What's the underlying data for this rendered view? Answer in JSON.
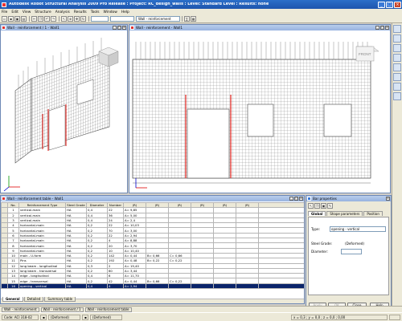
{
  "app": {
    "title": "Autodesk Robot Structural Analysis 2009 Pro Release : Project: RC_design_walls : Level: Standard Level : Results: none"
  },
  "menu": [
    "File",
    "Edit",
    "View",
    "Structure",
    "Analysis",
    "Results",
    "Tools",
    "Window",
    "Help"
  ],
  "toolbar": {
    "view_combo": "Wall - reinforcement"
  },
  "windows": {
    "left": {
      "title": "Wall - reinforcement / 1 - Wall1"
    },
    "right": {
      "title": "Wall - reinforcement - Wall1",
      "cube_label": "FRONT"
    },
    "table": {
      "title": "Wall - reinforcement table - Wall1"
    }
  },
  "table": {
    "headers": [
      "No.",
      "Reinforcement Type",
      "Steel Grade",
      "Diameter",
      "Number",
      "(R)",
      "(R)",
      "(R)",
      "(R)",
      "(R)",
      "(R)"
    ],
    "rows": [
      [
        "1",
        "vertical-main",
        "HA",
        "0,4",
        "22",
        "A= 9,85",
        "",
        "",
        "",
        "",
        ""
      ],
      [
        "2",
        "vertical-main",
        "HA",
        "0,4",
        "36",
        "A= 5,00",
        "",
        "",
        "",
        "",
        ""
      ],
      [
        "3",
        "vertical-main",
        "HA",
        "0,4",
        "24",
        "A= 2,4",
        "",
        "",
        "",
        "",
        ""
      ],
      [
        "4",
        "horizontal-main",
        "HA",
        "0,2",
        "22",
        "A= 10,03",
        "",
        "",
        "",
        "",
        ""
      ],
      [
        "5",
        "horizontal-main",
        "HA",
        "0,2",
        "70",
        "A= 3,00",
        "",
        "",
        "",
        "",
        ""
      ],
      [
        "6",
        "horizontal-main",
        "HA",
        "0,2",
        "22",
        "A= 2,94",
        "",
        "",
        "",
        "",
        ""
      ],
      [
        "7",
        "horizontal-main",
        "HA",
        "0,2",
        "4",
        "A= 8,88",
        "",
        "",
        "",
        "",
        ""
      ],
      [
        "8",
        "horizontal-main",
        "HA",
        "0,2",
        "20",
        "A= 3,70",
        "",
        "",
        "",
        "",
        ""
      ],
      [
        "9",
        "horizontal-main",
        "HA",
        "0,2",
        "10",
        "A= 10,40",
        "",
        "",
        "",
        "",
        ""
      ],
      [
        "10",
        "main - U-form",
        "HA",
        "0,2",
        "142",
        "A= 0,44",
        "B= 0,66",
        "C= 0,66",
        "",
        "",
        ""
      ],
      [
        "11",
        "Pins",
        "HA",
        "0,2",
        "192",
        "A= 0,48",
        "B= 0,22",
        "C= 0,22",
        "",
        "",
        ""
      ],
      [
        "12",
        "long beam - longitudinal",
        "HA",
        "0,3",
        "2",
        "A= 19,40",
        "",
        "",
        "",
        "",
        ""
      ],
      [
        "13",
        "long beam - transversal",
        "HA",
        "0,2",
        "60",
        "A= 3,44",
        "",
        "",
        "",
        "",
        ""
      ],
      [
        "14",
        "edge - longitudinal",
        "HA",
        "0,4",
        "6",
        "A= 11,70",
        "",
        "",
        "",
        "",
        ""
      ],
      [
        "15",
        "edge - transversal",
        "HA",
        "0,2",
        "42",
        "A= 0,44",
        "B= 0,66",
        "C= 0,22",
        "",
        "",
        ""
      ],
      [
        "16",
        "opening - vertical",
        "HA",
        "0,4",
        "4",
        "A= 2,94",
        "",
        "",
        "",
        "",
        ""
      ]
    ],
    "selected_row": 15,
    "bottom_tabs": [
      "General",
      "Detailed",
      "Summary table"
    ]
  },
  "bar_properties": {
    "title": "Bar properties",
    "tabs": [
      "Global",
      "Shape parameters",
      "Position"
    ],
    "type_label": "Type:",
    "type_value": "opening - vertical",
    "steel_grade_label": "Steel Grade:",
    "steel_grade_value": "(Deformed)",
    "diameter_label": "Diameter:",
    "diameter_value": "",
    "buttons": {
      "apply": "Apply",
      "ok": "OK",
      "close": "Close",
      "help": "Help"
    }
  },
  "taskbar": [
    "Wall - reinforcement",
    "Wall - reinforcement / 1",
    "Wall - reinforcement table"
  ],
  "statusbar": {
    "code": "Code: ACI 318-02",
    "steel": "(Deformed)",
    "material": "(Deformed)",
    "coords": "x = 0,3 ; y = 0,0 ; z = 0,0 ; 0,00"
  },
  "colors": {
    "accent_blue": "#2c6fc9",
    "rebar_grid": "#7a7a7a",
    "highlight_red": "#e0302b",
    "selection": "#0a246a"
  }
}
